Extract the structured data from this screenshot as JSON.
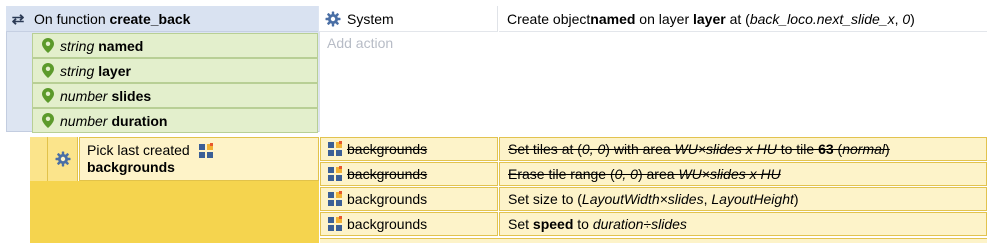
{
  "function_block": {
    "prefix": "On function",
    "name": "create_back",
    "params": [
      {
        "type": "string",
        "name": "named"
      },
      {
        "type": "string",
        "name": "layer"
      },
      {
        "type": "number",
        "name": "slides"
      },
      {
        "type": "number",
        "name": "duration"
      }
    ],
    "system_action": {
      "object": "System",
      "text_a": "Create object ",
      "text_b": "named",
      "text_c": " on layer ",
      "text_d": "layer",
      "text_e": " at (",
      "text_f": "back_loco.next_slide_x",
      "text_g": ", ",
      "text_h": "0",
      "text_i": ")"
    },
    "add_action": "Add action"
  },
  "sub_event": {
    "condition_line1": "Pick last created",
    "condition_line2": "backgrounds",
    "actions": [
      {
        "object": "backgrounds",
        "disabled": true,
        "parts": [
          "Set tiles at (",
          "0, 0",
          ") with area ",
          "WU×slides x HU",
          " to tile ",
          "63",
          " (",
          "normal",
          ")"
        ]
      },
      {
        "object": "backgrounds",
        "disabled": true,
        "parts": [
          "Erase tile range (",
          "0, 0",
          ") area ",
          "WU×slides x HU"
        ]
      },
      {
        "object": "backgrounds",
        "disabled": false,
        "parts": [
          "Set size to (",
          "LayoutWidth×slides",
          ", ",
          "LayoutHeight",
          ")"
        ]
      },
      {
        "object": "backgrounds",
        "disabled": false,
        "parts": [
          "Set ",
          "speed",
          " to ",
          "duration÷slides"
        ]
      }
    ]
  },
  "colors": {
    "function_bg": "#dde5f2",
    "param_bg": "#e3efcc",
    "subevent_yellow": "#f5d44e",
    "action_yellow": "#fdf3c9",
    "gear_blue": "#4a6fa5",
    "pin_green": "#5c9a2b"
  },
  "icons": [
    "loop-arrows-icon",
    "map-pin-icon",
    "gear-icon",
    "tilemap-object-icon"
  ]
}
